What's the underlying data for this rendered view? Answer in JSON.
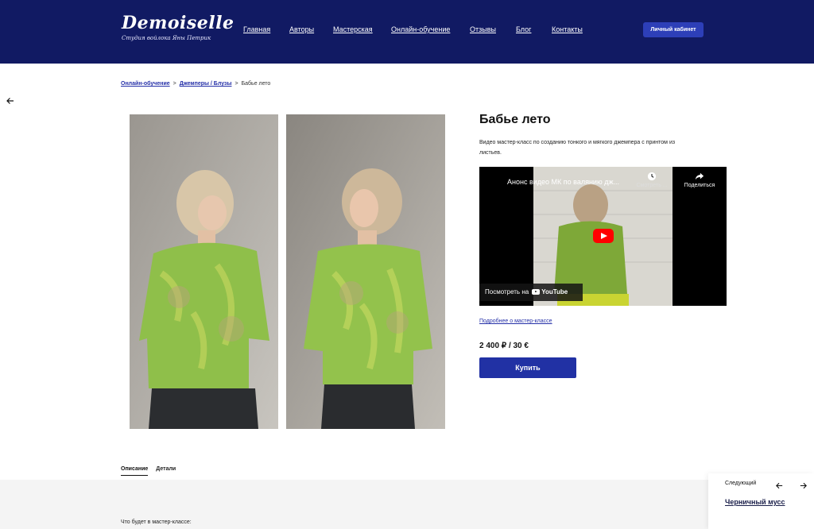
{
  "header": {
    "logo_title": "Demoiselle",
    "logo_subtitle": "Студия войлока Яны Петрик",
    "nav": [
      {
        "label": "Главная"
      },
      {
        "label": "Авторы"
      },
      {
        "label": "Мастерская"
      },
      {
        "label": "Онлайн-обучение"
      },
      {
        "label": "Отзывы"
      },
      {
        "label": "Блог"
      },
      {
        "label": "Контакты"
      }
    ],
    "cabinet_button": "Личный кабинет"
  },
  "breadcrumb": {
    "items": [
      "Онлайн-обучение",
      "Джемперы / Блузы"
    ],
    "separator": ">",
    "current": "Бабье лето"
  },
  "product": {
    "title": "Бабье лето",
    "description": "Видео мастер-класс по созданию тонкого и мягкого джемпера с принтом из листьев.",
    "video": {
      "title": "Анонс видео МК по валянию дж...",
      "watch_later": "Смотреть ...",
      "share": "Поделиться",
      "watch_on": "Посмотреть на",
      "platform": "YouTube"
    },
    "more_link": "Подробнее о мастер-классе",
    "price": "2 400 ₽ / 30 €",
    "buy_button": "Купить"
  },
  "tabs": [
    {
      "label": "Описание",
      "active": true
    },
    {
      "label": "Детали",
      "active": false
    }
  ],
  "description_section": {
    "heading": "Что будет в мастер-классе:"
  },
  "next_panel": {
    "label": "Следующий",
    "title": "Черничный мусс"
  },
  "colors": {
    "header_bg": "#111a63",
    "accent": "#2131a4",
    "link": "#2530a8",
    "sweater_green": "#8fbf4a"
  }
}
